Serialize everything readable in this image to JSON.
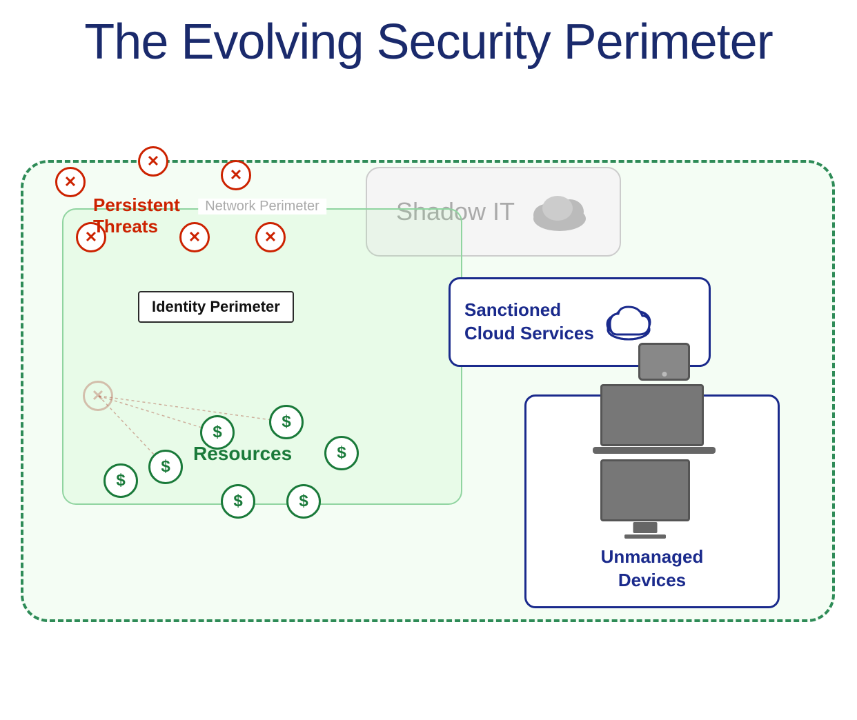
{
  "title": "The Evolving Security Perimeter",
  "elements": {
    "persistent_threats": "Persistent\nThreats",
    "identity_perimeter": "Identity Perimeter",
    "shadow_it": "Shadow IT",
    "network_perimeter": "Network Perimeter",
    "sanctioned_cloud": "Sanctioned\nCloud Services",
    "resources": "Resources",
    "unmanaged_devices": "Unmanaged\nDevices"
  },
  "colors": {
    "title": "#1a2a6c",
    "threat_red": "#cc2200",
    "green_border": "#2e8b57",
    "navy": "#1a2a8c",
    "green_resource": "#1a7a3a",
    "gray_shadow": "#aaaaaa",
    "faded_threat": "rgba(180,100,80,0.4)"
  }
}
